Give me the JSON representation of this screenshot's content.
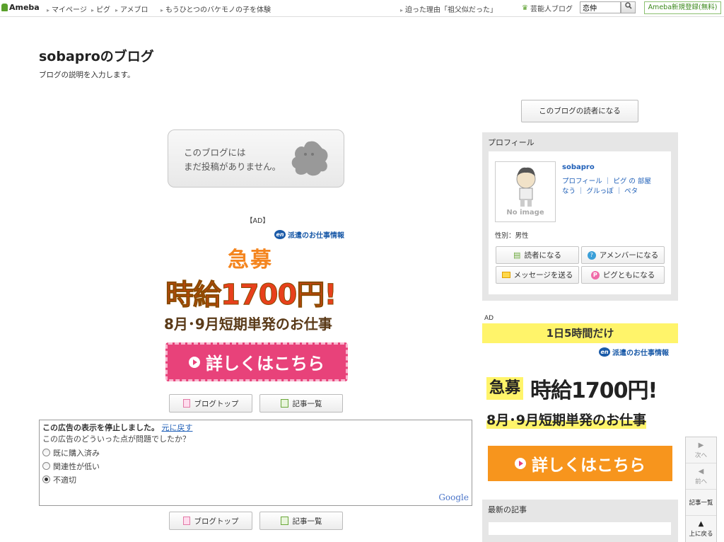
{
  "topbar": {
    "logo": "Ameba",
    "nav": [
      "マイページ",
      "ピグ",
      "アメブロ",
      "もうひとつのバケモノの子を体験"
    ],
    "news": "迫った理由「祖父似だった」",
    "celeb_blog": "芸能人ブログ",
    "search_value": "恋仲",
    "search_icon": "search-icon",
    "register": "Ameba新規登録(無料)"
  },
  "header": {
    "title": "sobaproのブログ",
    "description": "ブログの説明を入力します。"
  },
  "main": {
    "no_posts_line1": "このブログには",
    "no_posts_line2": "まだ投稿がありません。",
    "ad_label": "【AD】",
    "ad": {
      "brand": "派遣のお仕事情報",
      "brand_badge": "en",
      "headline_small": "急募",
      "headline_big": "時給1700円!",
      "sub": "8月･9月短期単発のお仕事",
      "cta": "詳しくはこちら"
    },
    "blog_top": "ブログトップ",
    "article_list": "記事一覧"
  },
  "feedback": {
    "stopped": "この広告の表示を停止しました。",
    "undo": "元に戻す",
    "question": "この広告のどういった点が問題でしたか？",
    "options": [
      "既に購入済み",
      "関連性が低い",
      "不適切"
    ],
    "selected": "不適切",
    "google": "Google"
  },
  "sidebar": {
    "reader_button": "このブログの読者になる",
    "profile": {
      "heading": "プロフィール",
      "name": "sobapro",
      "links_line1": "プロフィール ｜ ピグ の 部屋",
      "links_line2": "なう ｜ グルっぽ ｜ ペタ",
      "no_image": "No image",
      "gender": "性別：男性",
      "buttons": [
        "読者になる",
        "アメンバーになる",
        "メッセージを送る",
        "ピグともになる"
      ]
    },
    "ad_label": "AD",
    "ad": {
      "top_banner": "1日5時間だけ",
      "brand": "派遣のお仕事情報",
      "brand_badge": "en",
      "headline_small": "急募",
      "headline_big": "時給1700円!",
      "sub": "8月･9月短期単発のお仕事",
      "cta": "詳しくはこちら"
    },
    "latest_heading": "最新の記事"
  },
  "right_nav": {
    "next": "次へ",
    "prev": "前へ",
    "list": "記事一覧",
    "top": "上に戻る"
  },
  "colors": {
    "accent_green": "#5aa02c",
    "link_blue": "#2060b8",
    "cta_pink": "#e8427a",
    "cta_orange": "#f7951d",
    "banner_yellow": "#fff46a"
  }
}
